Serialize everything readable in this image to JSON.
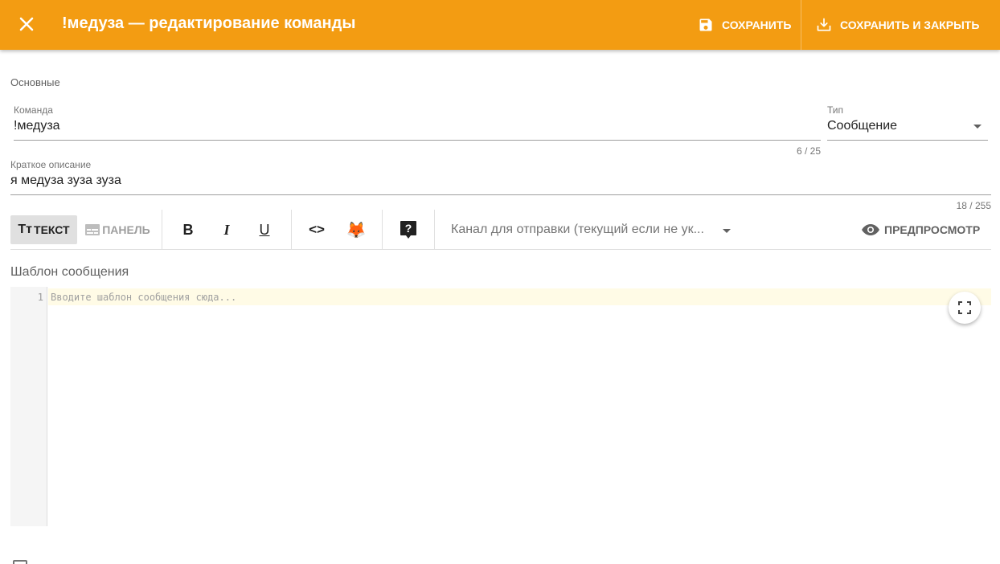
{
  "header": {
    "title": "!медуза — редактирование команды",
    "save_label": "СОХРАНИТЬ",
    "save_close_label": "СОХРАНИТЬ И ЗАКРЫТЬ",
    "accent_color": "#f39c12"
  },
  "form": {
    "section_label": "Основные",
    "command": {
      "label": "Команда",
      "value": "!медуза",
      "counter": "6 / 25"
    },
    "type": {
      "label": "Тип",
      "value": "Сообщение"
    },
    "description": {
      "label": "Краткое описание",
      "value": "я медуза зуза зуза",
      "counter": "18 / 255"
    }
  },
  "toolbar": {
    "text_mode": "ТЕКСТ",
    "text_mode_icon": "Tт",
    "panel_mode": "ПАНЕЛЬ",
    "bold": "B",
    "italic": "I",
    "underline": "U",
    "code": "<>",
    "emoji": "🦊",
    "help": "?",
    "channel_placeholder": "Канал для отправки (текущий если не ук...",
    "preview_label": "ПРЕДПРОСМОТР"
  },
  "editor": {
    "label": "Шаблон сообщения",
    "line_number": "1",
    "placeholder": "Вводите шаблон сообщения сюда..."
  }
}
